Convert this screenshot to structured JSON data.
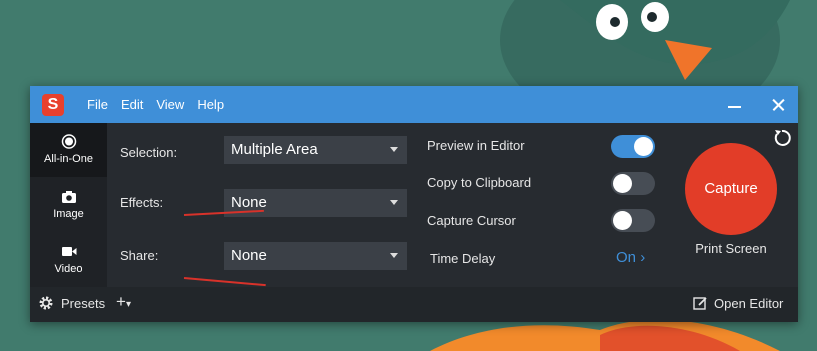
{
  "app": {
    "logo_letter": "S"
  },
  "menu": [
    "File",
    "Edit",
    "View",
    "Help"
  ],
  "modes": [
    {
      "label": "All-in-One",
      "icon": "all-in-one-icon",
      "active": true
    },
    {
      "label": "Image",
      "icon": "camera-icon",
      "active": false
    },
    {
      "label": "Video",
      "icon": "video-camera-icon",
      "active": false
    }
  ],
  "settings": {
    "selection": {
      "label": "Selection:",
      "value": "Multiple Area"
    },
    "effects": {
      "label": "Effects:",
      "value": "None"
    },
    "share": {
      "label": "Share:",
      "value": "None"
    }
  },
  "options": {
    "preview": {
      "label": "Preview in Editor",
      "on": true
    },
    "clipboard": {
      "label": "Copy to Clipboard",
      "on": false
    },
    "cursor": {
      "label": "Capture Cursor",
      "on": false
    },
    "delay": {
      "label": "Time Delay",
      "value": "On"
    }
  },
  "capture": {
    "label": "Capture",
    "hotkey": "Print Screen"
  },
  "footer": {
    "presets": "Presets",
    "open_editor": "Open Editor"
  },
  "colors": {
    "titlebar": "#3f8fd8",
    "capture": "#e23d28",
    "accent": "#3f8fd8",
    "body": "#272b30"
  }
}
